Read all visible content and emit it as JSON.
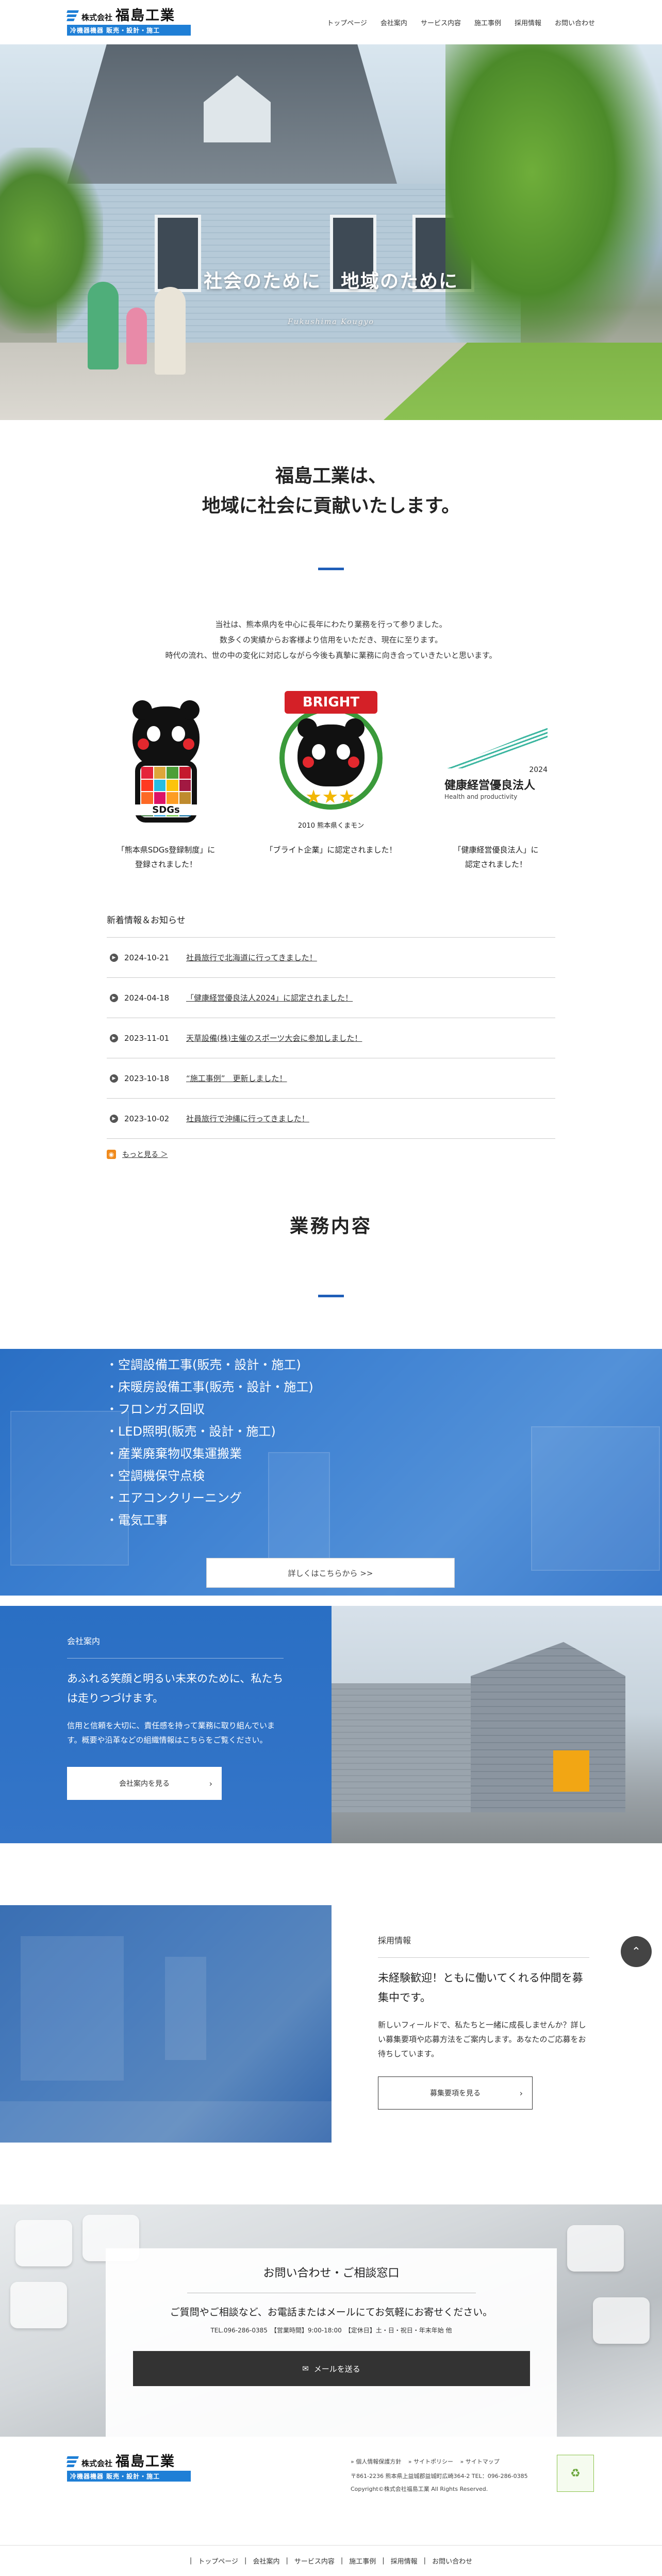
{
  "header": {
    "logo_kk": "株式会社",
    "logo_name": "福島工業",
    "logo_sub": "冷機器機器 販売・設計・施工",
    "nav": [
      "トップページ",
      "会社案内",
      "サービス内容",
      "施工事例",
      "採用情報",
      "お問い合わせ"
    ]
  },
  "hero": {
    "title": "社会のために　地域のために",
    "subtitle": "Fukushima Kougyo"
  },
  "intro": {
    "heading_line1": "福島工業は、",
    "heading_line2": "地域に社会に貢献いたします。",
    "body": [
      "当社は、熊本県内を中心に長年にわたり業務を行って参りました。",
      "数多くの実績からお客様より信用をいただき、現在に至ります。",
      "時代の流れ、世の中の変化に対応しながら今後も真摯に業務に向き合っていきたいと思います。"
    ]
  },
  "badges": [
    {
      "image_text": "SDGs",
      "caption": [
        "「熊本県SDGs登録制度」に",
        "登録されました！"
      ]
    },
    {
      "image_text": "BRIGHT",
      "image_sub": "2010 熊本県くまモン",
      "caption": [
        "「ブライト企業」に認定されました！"
      ]
    },
    {
      "image_text": "健康経営優良法人",
      "image_year": "2024",
      "image_sub": "Health and productivity",
      "caption": [
        "「健康経営優良法人」に",
        "認定されました！"
      ]
    }
  ],
  "news": {
    "title": "新着情報＆お知らせ",
    "items": [
      {
        "date": "2024-10-21",
        "text": "社員旅行で北海道に行ってきました！"
      },
      {
        "date": "2024-04-18",
        "text": "「健康経営優良法人2024」に認定されました！"
      },
      {
        "date": "2023-11-01",
        "text": "天草設備(株)主催のスポーツ大会に参加しました！"
      },
      {
        "date": "2023-10-18",
        "text": "“施工事例”　更新しました！"
      },
      {
        "date": "2023-10-02",
        "text": "社員旅行で沖縄に行ってきました！"
      }
    ],
    "more": "もっと見る ＞"
  },
  "services": {
    "title": "業務内容",
    "items": [
      "・空調設備工事(販売・設計・施工)",
      "・床暖房設備工事(販売・設計・施工)",
      "・フロンガス回収",
      "・LED照明(販売・設計・施工)",
      "・産業廃棄物収集運搬業",
      "・空調機保守点検",
      "・エアコンクリーニング",
      "・電気工事"
    ],
    "button": "詳しくはこちらから >>"
  },
  "company": {
    "label": "会社案内",
    "heading": "あふれる笑顔と明るい未来のために、私たちは走りつづけます。",
    "body": "信用と信頼を大切に、責任感を持って業務に取り組んでいます。概要や沿革などの組織情報はこちらをご覧ください。",
    "button": "会社案内を見る"
  },
  "recruit": {
    "label": "採用情報",
    "heading": "未経験歓迎！ともに働いてくれる仲間を募集中です。",
    "body": "新しいフィールドで、私たちと一緒に成長しませんか？詳しい募集要項や応募方法をご案内します。あなたのご応募をお待ちしています。",
    "button": "募集要項を見る"
  },
  "contact": {
    "title": "お問い合わせ・ご相談窓口",
    "lead": "ご質問やご相談など、お電話またはメールにてお気軽にお寄せください。",
    "info": "TEL.096-286-0385　【営業時間】9:00-18:00　【定休日】土・日・祝日・年末年始 他",
    "button": "メールを送る"
  },
  "footer": {
    "links": [
      "» 個人情報保護方針",
      "» サイトポリシー",
      "» サイトマップ"
    ],
    "address": "〒861-2236 熊本県上益城郡益城町広崎364-2 TEL：096-286-0385",
    "copyright": "Copyright©株式会社福島工業 All Rights Reserved.",
    "bar": [
      "トップページ",
      "会社案内",
      "サービス内容",
      "施工事例",
      "採用情報",
      "お問い合わせ"
    ]
  },
  "colors": {
    "brand_blue": "#1f7fd6",
    "section_blue": "#2a6fc4",
    "accent_rule": "#1f5eb8",
    "dark_button": "#333333"
  }
}
